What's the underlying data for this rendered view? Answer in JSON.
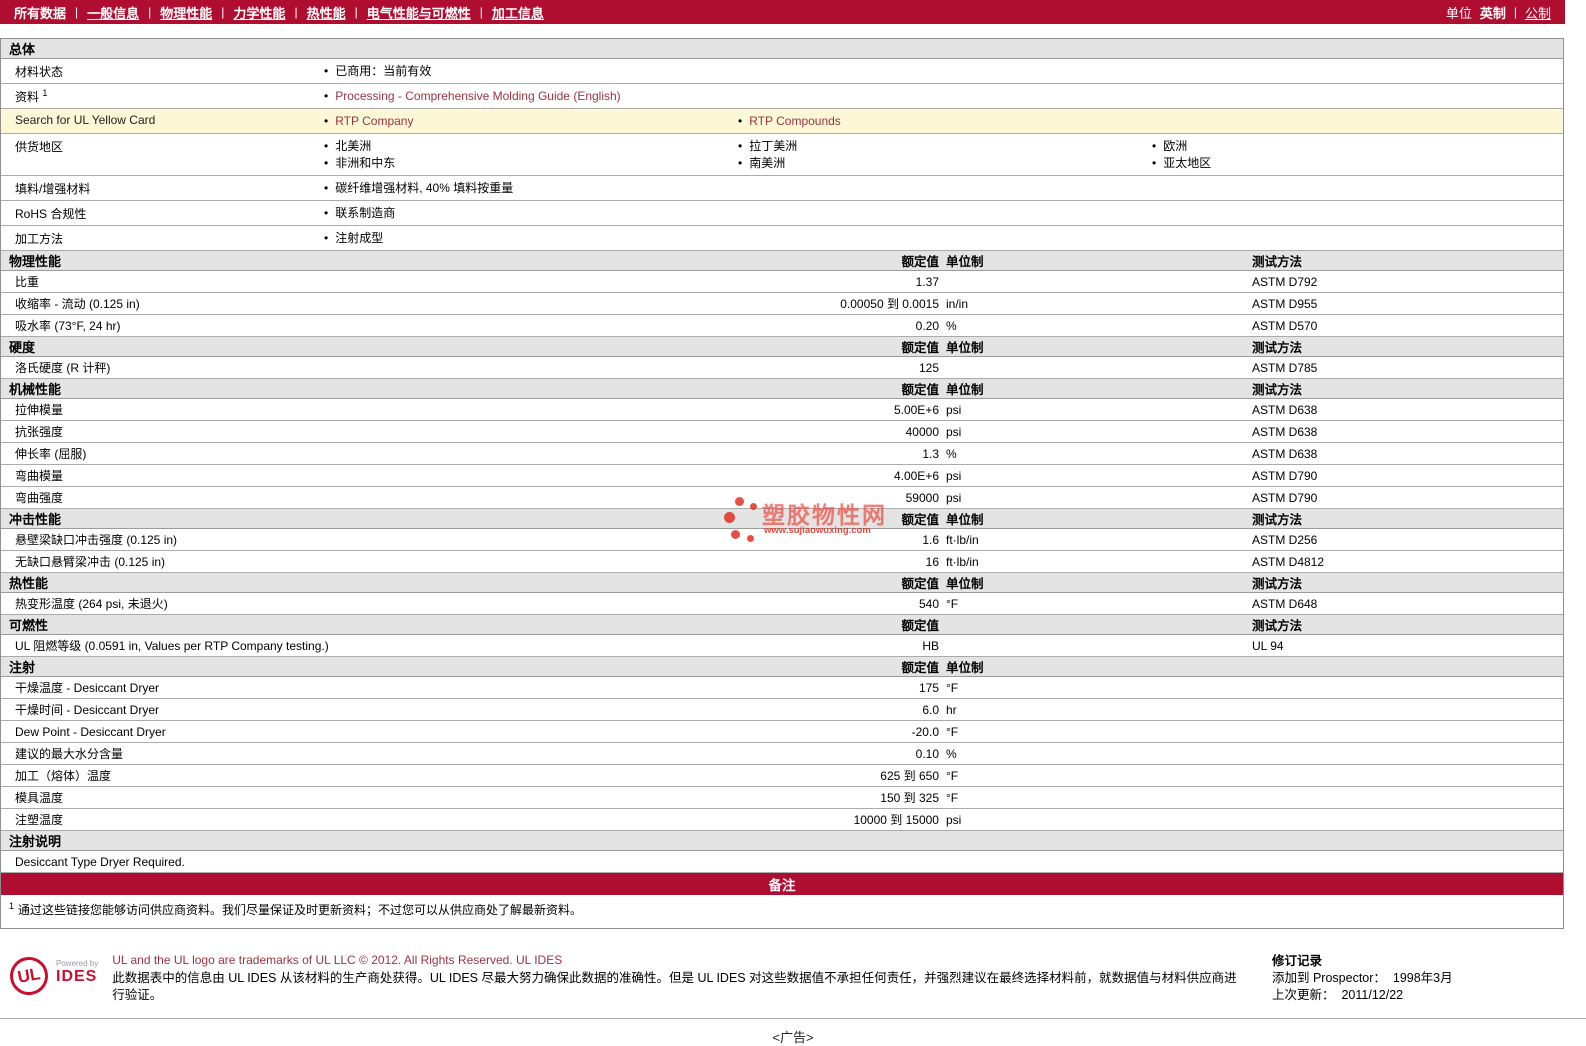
{
  "nav": {
    "items": [
      {
        "label": "所有数据",
        "active": true
      },
      {
        "label": "一般信息",
        "active": false
      },
      {
        "label": "物理性能",
        "active": false
      },
      {
        "label": "力学性能",
        "active": false
      },
      {
        "label": "热性能",
        "active": false
      },
      {
        "label": "电气性能与可燃性",
        "active": false
      },
      {
        "label": "加工信息",
        "active": false
      }
    ],
    "units_label": "单位",
    "unit_current": "英制",
    "unit_other": "公制"
  },
  "general": {
    "title": "总体",
    "rows": [
      {
        "label": "材料状态",
        "sup": "",
        "link": false,
        "highlight": false,
        "cols": [
          [
            "已商用：当前有效"
          ],
          [],
          []
        ]
      },
      {
        "label": "资料",
        "sup": "1",
        "link": true,
        "highlight": false,
        "cols": [
          [
            "Processing - Comprehensive Molding Guide (English)"
          ],
          [],
          []
        ]
      },
      {
        "label": "Search for UL Yellow Card",
        "sup": "",
        "link": true,
        "highlight": true,
        "cols": [
          [
            "RTP Company"
          ],
          [
            "RTP Compounds"
          ],
          []
        ]
      },
      {
        "label": "供货地区",
        "sup": "",
        "link": false,
        "highlight": false,
        "cols": [
          [
            "北美洲",
            "非洲和中东"
          ],
          [
            "拉丁美洲",
            "南美洲"
          ],
          [
            "欧洲",
            "亚太地区"
          ]
        ]
      },
      {
        "label": "填料/增强材料",
        "sup": "",
        "link": false,
        "highlight": false,
        "cols": [
          [
            "碳纤维增强材料, 40% 填料按重量"
          ],
          [],
          []
        ]
      },
      {
        "label": "RoHS 合规性",
        "sup": "",
        "link": false,
        "highlight": false,
        "cols": [
          [
            "联系制造商"
          ],
          [],
          []
        ]
      },
      {
        "label": "加工方法",
        "sup": "",
        "link": false,
        "highlight": false,
        "cols": [
          [
            "注射成型"
          ],
          [],
          []
        ]
      }
    ]
  },
  "sections": [
    {
      "title": "物理性能",
      "col_value": "额定值",
      "col_unit": "单位制",
      "col_method": "测试方法",
      "rows": [
        {
          "label": "比重",
          "value": "1.37",
          "unit": "",
          "method": "ASTM D792"
        },
        {
          "label": "收缩率 - 流动  (0.125 in)",
          "value": "0.00050 到  0.0015",
          "unit": "in/in",
          "method": "ASTM D955"
        },
        {
          "label": "吸水率  (73°F, 24 hr)",
          "value": "0.20",
          "unit": "%",
          "method": "ASTM D570"
        }
      ]
    },
    {
      "title": "硬度",
      "col_value": "额定值",
      "col_unit": "单位制",
      "col_method": "测试方法",
      "rows": [
        {
          "label": "洛氏硬度  (R 计秤)",
          "value": "125",
          "unit": "",
          "method": "ASTM D785"
        }
      ]
    },
    {
      "title": "机械性能",
      "col_value": "额定值",
      "col_unit": "单位制",
      "col_method": "测试方法",
      "rows": [
        {
          "label": "拉伸模量",
          "value": "5.00E+6",
          "unit": "psi",
          "method": "ASTM D638"
        },
        {
          "label": "抗张强度",
          "value": "40000",
          "unit": "psi",
          "method": "ASTM D638"
        },
        {
          "label": "伸长率  (屈服)",
          "value": "1.3",
          "unit": "%",
          "method": "ASTM D638"
        },
        {
          "label": "弯曲模量",
          "value": "4.00E+6",
          "unit": "psi",
          "method": "ASTM D790"
        },
        {
          "label": "弯曲强度",
          "value": "59000",
          "unit": "psi",
          "method": "ASTM D790"
        }
      ]
    },
    {
      "title": "冲击性能",
      "col_value": "额定值",
      "col_unit": "单位制",
      "col_method": "测试方法",
      "rows": [
        {
          "label": "悬壁梁缺口冲击强度  (0.125 in)",
          "value": "1.6",
          "unit": "ft·lb/in",
          "method": "ASTM D256"
        },
        {
          "label": "无缺口悬臂梁冲击  (0.125 in)",
          "value": "16",
          "unit": "ft·lb/in",
          "method": "ASTM D4812"
        }
      ]
    },
    {
      "title": "热性能",
      "col_value": "额定值",
      "col_unit": "单位制",
      "col_method": "测试方法",
      "rows": [
        {
          "label": "热变形温度  (264 psi, 未退火)",
          "value": "540",
          "unit": "°F",
          "method": "ASTM D648"
        }
      ]
    },
    {
      "title": "可燃性",
      "col_value": "额定值",
      "col_unit": "",
      "col_method": "测试方法",
      "rows": [
        {
          "label": "UL 阻燃等级  (0.0591 in, Values per RTP Company testing.)",
          "value": "HB",
          "unit": "",
          "method": "UL 94"
        }
      ]
    },
    {
      "title": "注射",
      "col_value": "额定值",
      "col_unit": "单位制",
      "col_method": "",
      "rows": [
        {
          "label": "干燥温度  - Desiccant Dryer",
          "value": "175",
          "unit": "°F",
          "method": ""
        },
        {
          "label": "干燥时间  - Desiccant Dryer",
          "value": "6.0",
          "unit": "hr",
          "method": ""
        },
        {
          "label": "Dew Point - Desiccant Dryer",
          "value": "-20.0",
          "unit": "°F",
          "method": ""
        },
        {
          "label": "建议的最大水分含量",
          "value": "0.10",
          "unit": "%",
          "method": ""
        },
        {
          "label": "加工（熔体）温度",
          "value": "625 到  650",
          "unit": "°F",
          "method": ""
        },
        {
          "label": "模具温度",
          "value": "150 到  325",
          "unit": "°F",
          "method": ""
        },
        {
          "label": "注塑温度",
          "value": "10000 到  15000",
          "unit": "psi",
          "method": ""
        }
      ]
    }
  ],
  "process_notes": {
    "title": "注射说明",
    "text": "Desiccant Type Dryer Required."
  },
  "remarks": {
    "title": "备注",
    "footnote_sup": "1",
    "footnote": "通过这些链接您能够访问供应商资料。我们尽量保证及时更新资料；不过您可以从供应商处了解最新资料。"
  },
  "watermark": {
    "name": "塑胶物性网",
    "url": "www.sujiaowuxing.com"
  },
  "footer": {
    "ul_monogram": "UL",
    "powered_by": "Powered by",
    "ides": "IDES",
    "line1": "UL and the UL logo are trademarks of UL LLC © 2012. All Rights Reserved. UL IDES",
    "line2": "此数据表中的信息由  UL IDES 从该材料的生产商处获得。UL IDES 尽最大努力确保此数据的准确性。但是  UL IDES 对这些数据值不承担任何责任，并强烈建议在最终选择材料前，就数据值与材料供应商进行验证。",
    "revision_title": "修订记录",
    "added_label": "添加到  Prospector：",
    "added_value": "1998年3月",
    "updated_label": "上次更新：",
    "updated_value": "2011/12/22"
  },
  "ad": {
    "text": "<广告>"
  }
}
